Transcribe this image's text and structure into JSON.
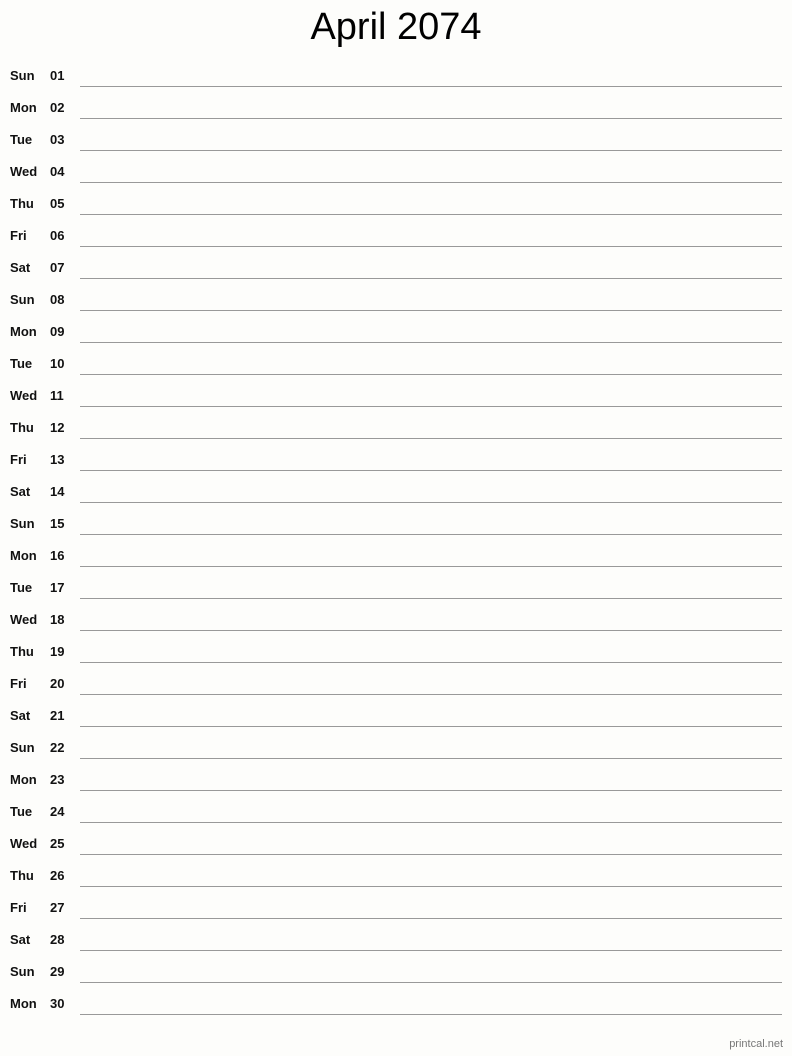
{
  "title": "April 2074",
  "days": [
    {
      "dow": "Sun",
      "num": "01"
    },
    {
      "dow": "Mon",
      "num": "02"
    },
    {
      "dow": "Tue",
      "num": "03"
    },
    {
      "dow": "Wed",
      "num": "04"
    },
    {
      "dow": "Thu",
      "num": "05"
    },
    {
      "dow": "Fri",
      "num": "06"
    },
    {
      "dow": "Sat",
      "num": "07"
    },
    {
      "dow": "Sun",
      "num": "08"
    },
    {
      "dow": "Mon",
      "num": "09"
    },
    {
      "dow": "Tue",
      "num": "10"
    },
    {
      "dow": "Wed",
      "num": "11"
    },
    {
      "dow": "Thu",
      "num": "12"
    },
    {
      "dow": "Fri",
      "num": "13"
    },
    {
      "dow": "Sat",
      "num": "14"
    },
    {
      "dow": "Sun",
      "num": "15"
    },
    {
      "dow": "Mon",
      "num": "16"
    },
    {
      "dow": "Tue",
      "num": "17"
    },
    {
      "dow": "Wed",
      "num": "18"
    },
    {
      "dow": "Thu",
      "num": "19"
    },
    {
      "dow": "Fri",
      "num": "20"
    },
    {
      "dow": "Sat",
      "num": "21"
    },
    {
      "dow": "Sun",
      "num": "22"
    },
    {
      "dow": "Mon",
      "num": "23"
    },
    {
      "dow": "Tue",
      "num": "24"
    },
    {
      "dow": "Wed",
      "num": "25"
    },
    {
      "dow": "Thu",
      "num": "26"
    },
    {
      "dow": "Fri",
      "num": "27"
    },
    {
      "dow": "Sat",
      "num": "28"
    },
    {
      "dow": "Sun",
      "num": "29"
    },
    {
      "dow": "Mon",
      "num": "30"
    }
  ],
  "footer": "printcal.net"
}
